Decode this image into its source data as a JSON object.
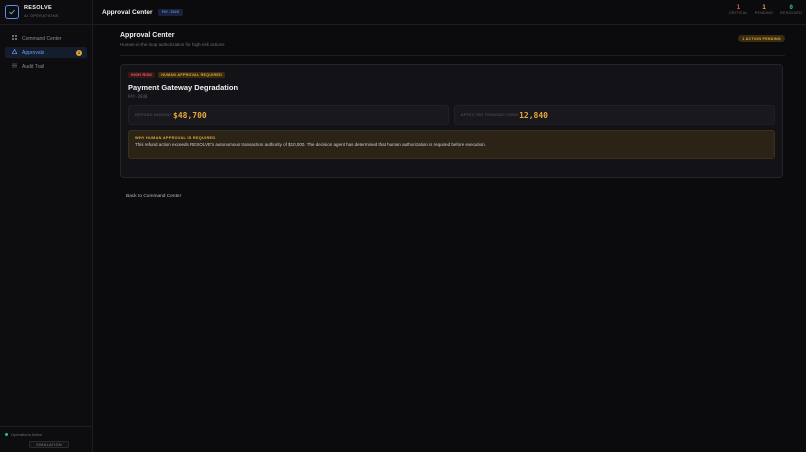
{
  "brand": {
    "name": "RESOLVE",
    "subtitle": "AI OPERATIONS"
  },
  "sidebar": {
    "items": [
      {
        "label": "Command Center",
        "icon": "grid-icon",
        "active": false
      },
      {
        "label": "Approvals",
        "icon": "warning-icon",
        "active": true,
        "badge": "1"
      },
      {
        "label": "Audit Trail",
        "icon": "list-icon",
        "active": false
      }
    ],
    "footer": {
      "status": "Operations Active",
      "mode": "SIMULATION"
    }
  },
  "topbar": {
    "title": "Approval Center",
    "tag": "PAY-2848",
    "stats": [
      {
        "value": "1",
        "label": "CRITICAL",
        "color": "#e45b5b"
      },
      {
        "value": "1",
        "label": "PENDING",
        "color": "#e3ac3e"
      },
      {
        "value": "0",
        "label": "RESOLVED",
        "color": "#2fbf85"
      }
    ]
  },
  "page": {
    "title": "Approval Center",
    "subtitle": "Human-in-the-loop authorization for high-risk actions",
    "pending_badge": "1 ACTION PENDING"
  },
  "card": {
    "tags": {
      "risk": "HIGH RISK",
      "approval": "HUMAN APPROVAL REQUIRED"
    },
    "title": "Payment Gateway Degradation",
    "id": "PAY-2848",
    "metrics": [
      {
        "label": "REFUND AMOUNT",
        "value": "$48,700"
      },
      {
        "label": "AFFECTED TRANSACTIONS",
        "value": "12,840"
      }
    ],
    "reason": {
      "title": "WHY HUMAN APPROVAL IS REQUIRED",
      "text": "This refund action exceeds RESOLVE's autonomous transaction authority of $10,000. The decision agent has determined that human authorization is required before execution."
    }
  },
  "back_link": "Back to Command Center",
  "colors": {
    "accent": "#6f9df5",
    "warning": "#e3ac3e",
    "danger": "#e45b5b",
    "success": "#2fbf85"
  }
}
